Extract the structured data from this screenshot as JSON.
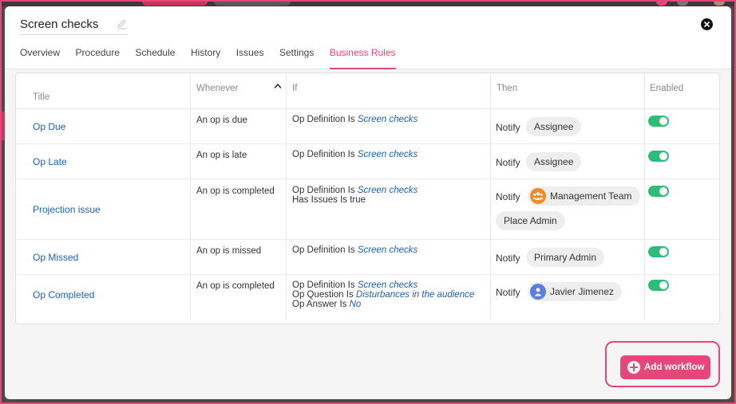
{
  "modal": {
    "title": "Screen checks",
    "tabs": [
      {
        "label": "Overview",
        "active": false
      },
      {
        "label": "Procedure",
        "active": false
      },
      {
        "label": "Schedule",
        "active": false
      },
      {
        "label": "History",
        "active": false
      },
      {
        "label": "Issues",
        "active": false
      },
      {
        "label": "Settings",
        "active": false
      },
      {
        "label": "Business Rules",
        "active": true
      }
    ]
  },
  "table": {
    "headers": {
      "title": "Title",
      "whenever": "Whenever",
      "if": "If",
      "then": "Then",
      "enabled": "Enabled"
    },
    "sort": {
      "column": "whenever",
      "direction": "ascending"
    },
    "rows": [
      {
        "title": "Op Due",
        "whenever": "An op is due",
        "conditions": [
          {
            "label": "Op Definition Is",
            "value": "Screen checks"
          }
        ],
        "notify": "Notify",
        "recipients": [
          {
            "label": "Assignee",
            "avatar": null
          }
        ],
        "enabled": true
      },
      {
        "title": "Op Late",
        "whenever": "An op is late",
        "conditions": [
          {
            "label": "Op Definition Is",
            "value": "Screen checks"
          }
        ],
        "notify": "Notify",
        "recipients": [
          {
            "label": "Assignee",
            "avatar": null
          }
        ],
        "enabled": true
      },
      {
        "title": "Projection issue",
        "whenever": "An op is completed",
        "conditions": [
          {
            "label": "Op Definition Is",
            "value": "Screen checks"
          },
          {
            "label": "Has Issues Is true",
            "value": ""
          }
        ],
        "notify": "Notify",
        "recipients": [
          {
            "label": "Management Team",
            "avatar": "team-icon"
          },
          {
            "label": "Place Admin",
            "avatar": null
          }
        ],
        "enabled": true
      },
      {
        "title": "Op Missed",
        "whenever": "An op is missed",
        "conditions": [
          {
            "label": "Op Definition Is",
            "value": "Screen checks"
          }
        ],
        "notify": "Notify",
        "recipients": [
          {
            "label": "Primary Admin",
            "avatar": null
          }
        ],
        "enabled": true
      },
      {
        "title": "Op Completed",
        "whenever": "An op is completed",
        "conditions": [
          {
            "label": "Op Definition Is",
            "value": "Screen checks"
          },
          {
            "label": "Op Question Is",
            "value": "Disturbances in the audience"
          },
          {
            "label": "Op Answer Is",
            "value": "No"
          }
        ],
        "notify": "Notify",
        "recipients": [
          {
            "label": "Javier Jimenez",
            "avatar": "user-icon"
          }
        ],
        "enabled": true
      }
    ]
  },
  "actions": {
    "add_workflow": "Add workflow"
  },
  "colors": {
    "accent": "#e8457a",
    "link": "#1f5fb3",
    "toggle_on": "#2ebd76",
    "team_avatar": "#f08a24",
    "user_avatar": "#5b7fe0"
  }
}
